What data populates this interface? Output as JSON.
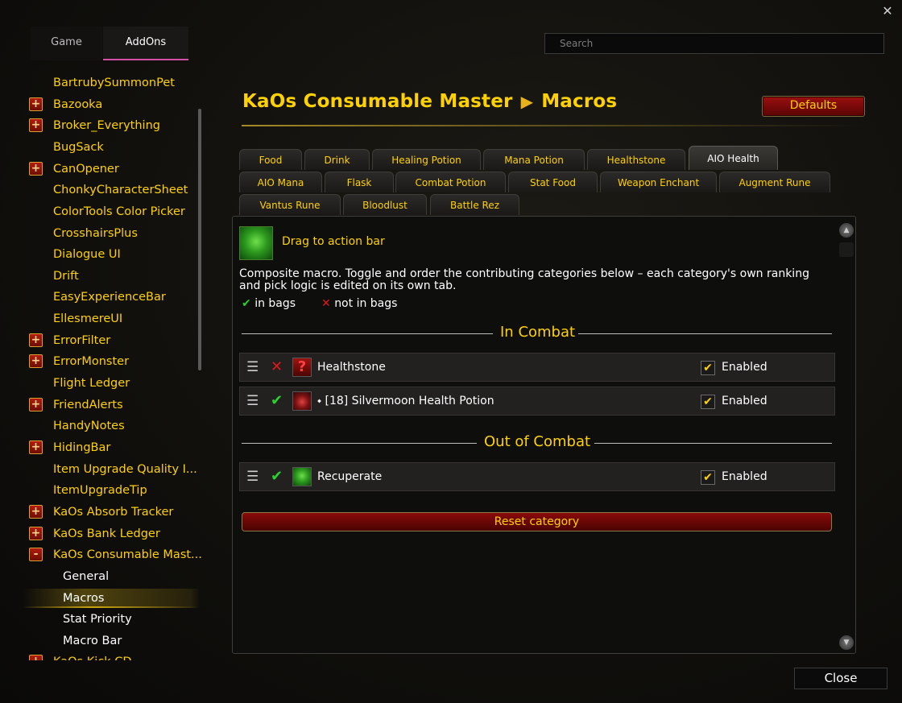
{
  "window": {
    "close_glyph": "✕"
  },
  "top_tabs": [
    {
      "label": "Game"
    },
    {
      "label": "AddOns"
    }
  ],
  "search": {
    "placeholder": "Search"
  },
  "sidebar": {
    "items": [
      {
        "label": "BartrubySummonPet",
        "toggle": ""
      },
      {
        "label": "Bazooka",
        "toggle": "+"
      },
      {
        "label": "Broker_Everything",
        "toggle": "+"
      },
      {
        "label": "BugSack",
        "toggle": ""
      },
      {
        "label": "CanOpener",
        "toggle": "+"
      },
      {
        "label": "ChonkyCharacterSheet",
        "toggle": ""
      },
      {
        "label": "ColorTools Color Picker",
        "toggle": ""
      },
      {
        "label": "CrosshairsPlus",
        "toggle": ""
      },
      {
        "label": "Dialogue UI",
        "toggle": ""
      },
      {
        "label": "Drift",
        "toggle": ""
      },
      {
        "label": "EasyExperienceBar",
        "toggle": ""
      },
      {
        "label": "EllesmereUI",
        "toggle": ""
      },
      {
        "label": "ErrorFilter",
        "toggle": "+"
      },
      {
        "label": "ErrorMonster",
        "toggle": "+"
      },
      {
        "label": "Flight Ledger",
        "toggle": ""
      },
      {
        "label": "FriendAlerts",
        "toggle": "+"
      },
      {
        "label": "HandyNotes",
        "toggle": ""
      },
      {
        "label": "HidingBar",
        "toggle": "+"
      },
      {
        "label": "Item Upgrade Quality I...",
        "toggle": ""
      },
      {
        "label": "ItemUpgradeTip",
        "toggle": ""
      },
      {
        "label": "KaOs Absorb Tracker",
        "toggle": "+"
      },
      {
        "label": "KaOs Bank Ledger",
        "toggle": "+"
      },
      {
        "label": "KaOs Consumable Mast...",
        "toggle": "-"
      }
    ],
    "children": [
      {
        "label": "General"
      },
      {
        "label": "Macros"
      },
      {
        "label": "Stat Priority"
      },
      {
        "label": "Macro Bar"
      }
    ],
    "partial_item": {
      "label": "KaOs Kick CD",
      "toggle": "+"
    }
  },
  "header": {
    "addon_title": "KaOs Consumable Master",
    "arrow": "▶",
    "page_title": "Macros",
    "defaults_label": "Defaults"
  },
  "category_tabs": [
    {
      "label": "Food"
    },
    {
      "label": "Drink"
    },
    {
      "label": "Healing Potion"
    },
    {
      "label": "Mana Potion"
    },
    {
      "label": "Healthstone"
    },
    {
      "label": "AIO Health"
    },
    {
      "label": "AIO Mana"
    },
    {
      "label": "Flask"
    },
    {
      "label": "Combat Potion"
    },
    {
      "label": "Stat Food"
    },
    {
      "label": "Weapon Enchant"
    },
    {
      "label": "Augment Rune"
    },
    {
      "label": "Vantus Rune"
    },
    {
      "label": "Bloodlust"
    },
    {
      "label": "Battle Rez"
    }
  ],
  "active_tab": "AIO Health",
  "content": {
    "drag_label": "Drag to action bar",
    "description": "Composite macro. Toggle and order the contributing categories below – each category's own ranking and pick logic is edited on its own tab.",
    "legend": {
      "in_bags_glyph": "✔",
      "in_bags": "in bags",
      "not_in_bags_glyph": "✕",
      "not_in_bags": "not in bags"
    },
    "sections": [
      {
        "title": "In Combat",
        "rows": [
          {
            "status": "missing",
            "name": "Healthstone",
            "enabled_label": "Enabled",
            "icon": "healthstone-icon"
          },
          {
            "status": "present",
            "name": "⬩ [18] Silvermoon Health Potion",
            "enabled_label": "Enabled",
            "icon": "potion-icon"
          }
        ]
      },
      {
        "title": "Out of Combat",
        "rows": [
          {
            "status": "present",
            "name": "Recuperate",
            "enabled_label": "Enabled",
            "icon": "recuperate-icon"
          }
        ]
      }
    ],
    "reset_label": "Reset category"
  },
  "footer": {
    "close_label": "Close"
  },
  "colors": {
    "accent_gold": "#ffd100",
    "present_green": "#2bd12b",
    "missing_red": "#e01818",
    "button_red": "#8a0a0a",
    "tab_underline": "#d24fa6"
  }
}
